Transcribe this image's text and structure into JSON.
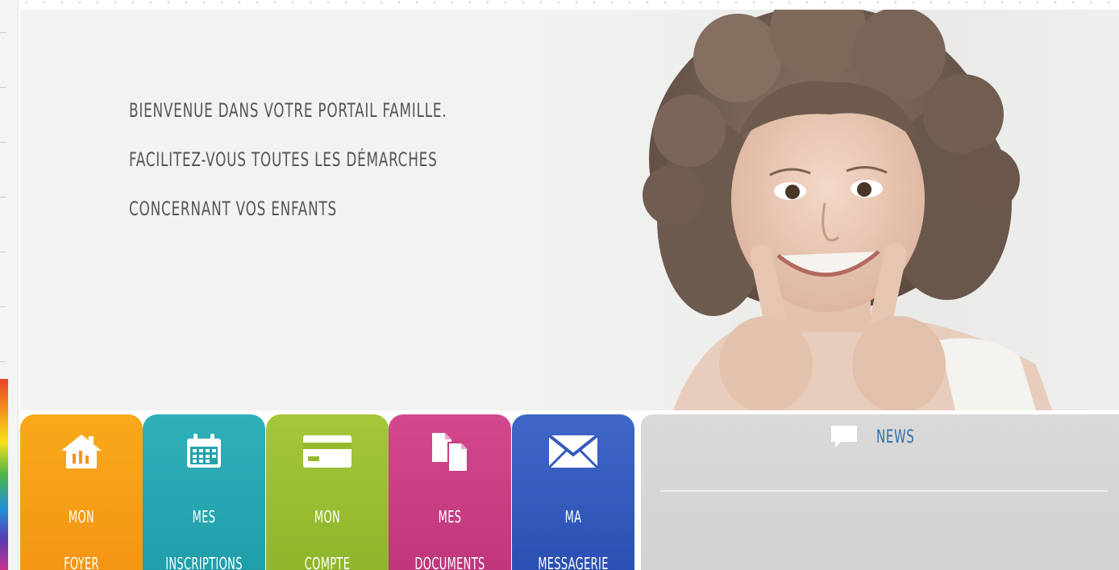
{
  "hero": {
    "welcome_lines": [
      "Bienvenue dans votre portail famille.",
      "Facilitez-vous toutes les démarches",
      "concernant vos enfants"
    ]
  },
  "tiles": [
    {
      "line1": "MON",
      "line2": "FOYER",
      "icon": "house-icon",
      "color": "#f5a01a"
    },
    {
      "line1": "MES",
      "line2": "INSCRIPTIONS",
      "icon": "calendar-icon",
      "color": "#28a9b3"
    },
    {
      "line1": "MON",
      "line2": "COMPTE",
      "icon": "credit-card-icon",
      "color": "#9bbd33"
    },
    {
      "line1": "MES",
      "line2": "DOCUMENTS",
      "icon": "documents-icon",
      "color": "#c93f85"
    },
    {
      "line1": "MA",
      "line2": "MESSAGERIE",
      "icon": "envelope-icon",
      "color": "#355bbd"
    }
  ],
  "news": {
    "title": "NEWS",
    "icon": "speech-bubble-icon",
    "title_color": "#2e6fb0"
  }
}
